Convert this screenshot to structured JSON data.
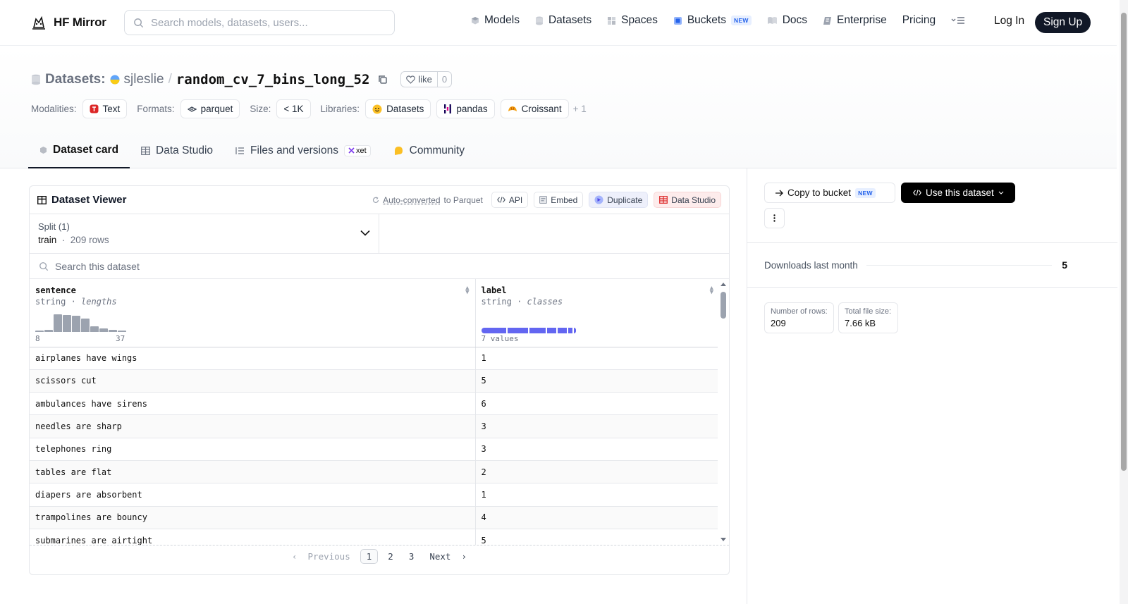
{
  "header": {
    "brand": "HF Mirror",
    "search_placeholder": "Search models, datasets, users...",
    "nav": [
      {
        "label": "Models",
        "icon": "cube-icon"
      },
      {
        "label": "Datasets",
        "icon": "database-icon"
      },
      {
        "label": "Spaces",
        "icon": "grid-icon"
      },
      {
        "label": "Buckets",
        "icon": "bucket-icon",
        "badge": "NEW"
      },
      {
        "label": "Docs",
        "icon": "book-icon"
      },
      {
        "label": "Enterprise",
        "icon": "enterprise-icon"
      },
      {
        "label": "Pricing"
      }
    ],
    "login": "Log In",
    "signup": "Sign Up"
  },
  "dataset": {
    "section_label": "Datasets:",
    "user": "sjleslie",
    "name": "random_cv_7_bins_long_52",
    "like_label": "like",
    "like_count": "0",
    "meta": {
      "modalities_label": "Modalities:",
      "modality": "Text",
      "formats_label": "Formats:",
      "format": "parquet",
      "size_label": "Size:",
      "size": "< 1K",
      "libraries_label": "Libraries:",
      "libraries": [
        "Datasets",
        "pandas",
        "Croissant"
      ],
      "more": "+ 1"
    },
    "tabs": [
      "Dataset card",
      "Data Studio",
      "Files and versions",
      "Community"
    ],
    "xet_label": "xet"
  },
  "viewer": {
    "title": "Dataset Viewer",
    "auto_converted": "Auto-converted",
    "to_parquet": "to Parquet",
    "actions": [
      "API",
      "Embed",
      "Duplicate",
      "Data Studio"
    ],
    "split_title": "Split (1)",
    "split_value": "train",
    "split_rows": "209 rows",
    "search_placeholder": "Search this dataset",
    "columns": [
      {
        "name": "sentence",
        "type": "string",
        "stat": "lengths",
        "min": "8",
        "max": "37"
      },
      {
        "name": "label",
        "type": "string",
        "stat": "classes",
        "values_label": "7 values"
      }
    ],
    "rows": [
      {
        "sentence": "airplanes have wings",
        "label": "1"
      },
      {
        "sentence": "scissors cut",
        "label": "5"
      },
      {
        "sentence": "ambulances have sirens",
        "label": "6"
      },
      {
        "sentence": "needles are sharp",
        "label": "3"
      },
      {
        "sentence": "telephones ring",
        "label": "3"
      },
      {
        "sentence": "tables are flat",
        "label": "2"
      },
      {
        "sentence": "diapers are absorbent",
        "label": "1"
      },
      {
        "sentence": "trampolines are bouncy",
        "label": "4"
      },
      {
        "sentence": "submarines are airtight",
        "label": "5"
      }
    ],
    "pager": {
      "prev": "Previous",
      "pages": [
        "1",
        "2",
        "3"
      ],
      "next": "Next"
    }
  },
  "sidebar": {
    "copy_to_bucket": "Copy to bucket",
    "copy_badge": "NEW",
    "use_dataset": "Use this dataset",
    "downloads_label": "Downloads last month",
    "downloads_value": "5",
    "rows_label": "Number of rows:",
    "rows_value": "209",
    "size_label": "Total file size:",
    "size_value": "7.66 kB"
  },
  "colors": {
    "accent_indigo": "#6366f1",
    "dark": "#111827"
  }
}
